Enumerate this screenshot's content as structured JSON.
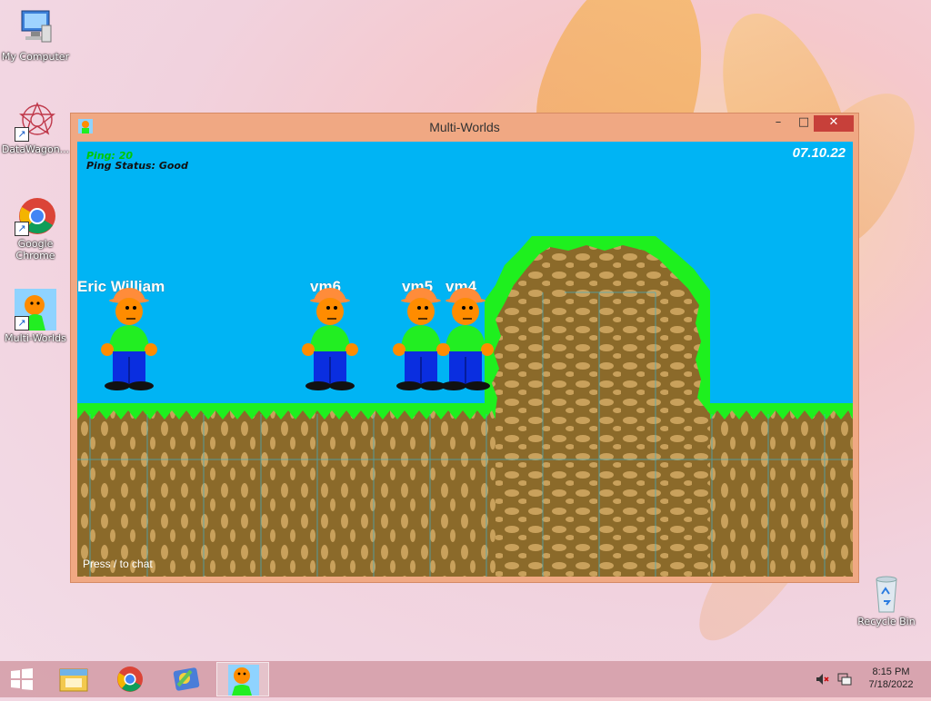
{
  "desktop": {
    "icons": [
      {
        "label": "My Computer"
      },
      {
        "label": "DataWagon..."
      },
      {
        "label": "Google Chrome"
      },
      {
        "label": "Multi-Worlds"
      },
      {
        "label": "Recycle Bin"
      }
    ]
  },
  "window": {
    "title": "Multi-Worlds",
    "minimize_glyph": "–",
    "maximize_glyph": "□",
    "close_glyph": "✕"
  },
  "game": {
    "ping_label": "Ping: 20",
    "ping_status": "Ping Status: Good",
    "date": "07.10.22",
    "chat_hint": "Press / to chat",
    "players": [
      {
        "name": "Eric William"
      },
      {
        "name": "vm6"
      },
      {
        "name": "vm5"
      },
      {
        "name": "vm4"
      }
    ],
    "colors": {
      "sky": "#00b4f4",
      "grass": "#1ef01e",
      "dirt": "#8b6a2a",
      "shirt": "#22ee22",
      "pants": "#0a2ee0",
      "skin": "#ff8c00"
    }
  },
  "taskbar": {
    "time": "8:15 PM",
    "date": "7/18/2022",
    "icons": [
      "windows-start-icon",
      "file-explorer-icon",
      "chrome-icon",
      "media-app-icon",
      "multi-worlds-icon"
    ]
  }
}
